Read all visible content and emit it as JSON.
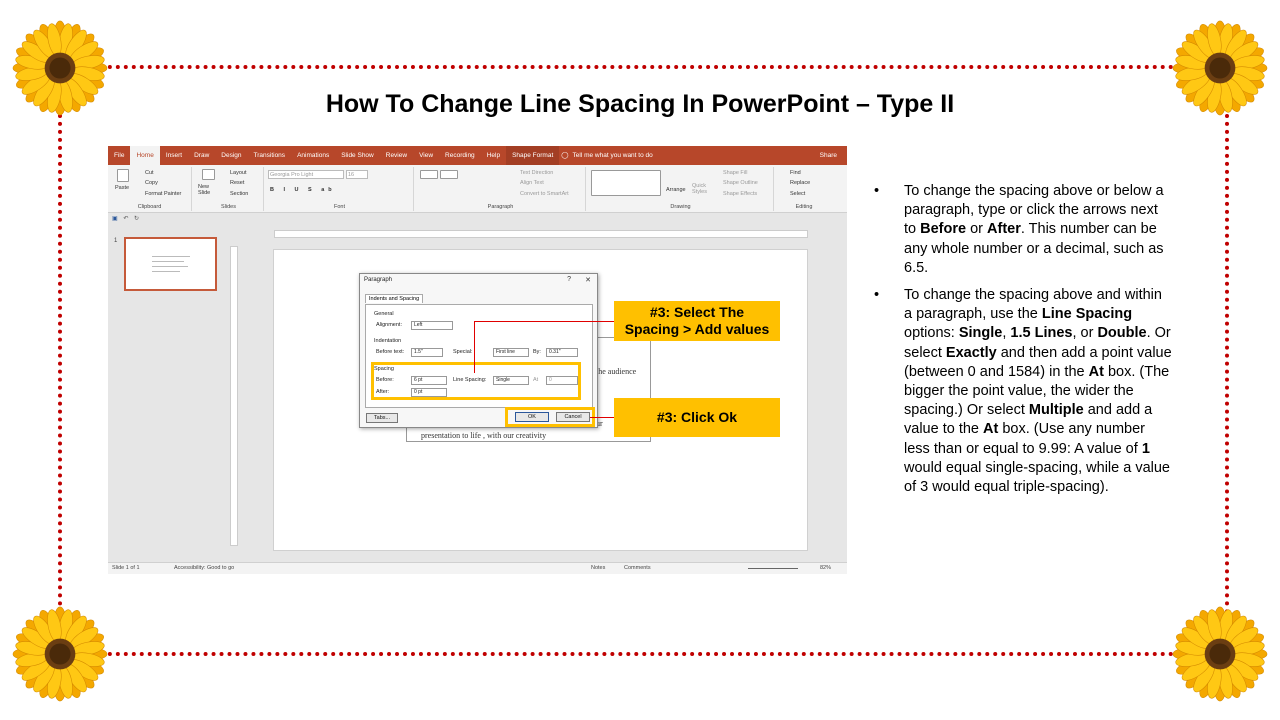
{
  "title": "How To Change Line Spacing In PowerPoint – Type II",
  "ribbon": {
    "tabs": [
      "File",
      "Home",
      "Insert",
      "Draw",
      "Design",
      "Transitions",
      "Animations",
      "Slide Show",
      "Review",
      "View",
      "Recording",
      "Help",
      "Shape Format"
    ],
    "active_tab": "Home",
    "tell_me": "Tell me what you want to do",
    "share": "Share",
    "clipboard": {
      "paste": "Paste",
      "cut": "Cut",
      "copy": "Copy",
      "format_painter": "Format Painter",
      "label": "Clipboard"
    },
    "slides": {
      "new_slide": "New Slide",
      "layout": "Layout",
      "reset": "Reset",
      "section": "Section",
      "label": "Slides"
    },
    "font": {
      "name": "Georgia Pro Light",
      "size": "16",
      "label": "Font"
    },
    "paragraph": {
      "text_direction": "Text Direction",
      "align_text": "Align Text",
      "convert_smartart": "Convert to SmartArt",
      "label": "Paragraph"
    },
    "drawing": {
      "arrange": "Arrange",
      "quick_styles": "Quick Styles",
      "shape_fill": "Shape Fill",
      "shape_outline": "Shape Outline",
      "shape_effects": "Shape Effects",
      "label": "Drawing"
    },
    "editing": {
      "find": "Find",
      "replace": "Replace",
      "select": "Select",
      "label": "Editing"
    }
  },
  "thumbnail_number": "1",
  "slide_text": {
    "line1": "s.",
    "line2": "the audience",
    "line3": "ur",
    "line4": "presentation to life , with our creativity"
  },
  "dialog": {
    "title": "Paragraph",
    "help": "?",
    "close": "✕",
    "tab": "Indents and Spacing",
    "general_label": "General",
    "alignment_label": "Alignment:",
    "alignment_value": "Left",
    "indentation_label": "Indentation",
    "before_text_label": "Before text:",
    "before_text_value": "1.5\"",
    "special_label": "Special:",
    "special_value": "First line",
    "by_label": "By:",
    "by_value": "0.31\"",
    "spacing_label": "Spacing",
    "before_label": "Before:",
    "before_value": "6 pt",
    "after_label": "After:",
    "after_value": "0 pt",
    "line_spacing_label": "Line Spacing:",
    "line_spacing_value": "Single",
    "at_label": "At",
    "at_value": "0",
    "tabs_button": "Tabs...",
    "ok_button": "OK",
    "cancel_button": "Cancel"
  },
  "statusbar": {
    "slide": "Slide 1 of 1",
    "accessibility": "Accessibility: Good to go",
    "notes": "Notes",
    "comments": "Comments",
    "zoom": "82%"
  },
  "callouts": {
    "select_spacing": "#3: Select The Spacing > Add values",
    "click_ok": "#3: Click Ok"
  },
  "bullets": [
    {
      "segments": [
        {
          "t": "To change the spacing above or below a paragraph, type or click the arrows next to ",
          "b": false
        },
        {
          "t": "Before",
          "b": true
        },
        {
          "t": " or ",
          "b": false
        },
        {
          "t": "After",
          "b": true
        },
        {
          "t": ". This number can be any whole number or a decimal, such as 6.5.",
          "b": false
        }
      ]
    },
    {
      "segments": [
        {
          "t": "To change the spacing above and within a paragraph, use the ",
          "b": false
        },
        {
          "t": "Line Spacing",
          "b": true
        },
        {
          "t": " options: ",
          "b": false
        },
        {
          "t": "Single",
          "b": true
        },
        {
          "t": ", ",
          "b": false
        },
        {
          "t": "1.5 Lines",
          "b": true
        },
        {
          "t": ", or ",
          "b": false
        },
        {
          "t": "Double",
          "b": true
        },
        {
          "t": ". Or select ",
          "b": false
        },
        {
          "t": "Exactly",
          "b": true
        },
        {
          "t": " and then add a point value (between 0 and 1584) in the ",
          "b": false
        },
        {
          "t": "At",
          "b": true
        },
        {
          "t": " box. (The bigger the point value, the wider the spacing.) Or select ",
          "b": false
        },
        {
          "t": "Multiple",
          "b": true
        },
        {
          "t": " and add a value to the ",
          "b": false
        },
        {
          "t": "At",
          "b": true
        },
        {
          "t": " box. (Use any number less than or equal to 9.99: A value of ",
          "b": false
        },
        {
          "t": "1",
          "b": true
        },
        {
          "t": " would equal single-spacing, while a value of 3 would equal triple-spacing).",
          "b": false
        }
      ]
    }
  ],
  "bullet_char": "•",
  "colors": {
    "frame": "#c00000",
    "callout": "#ffc000",
    "ppt_accent": "#b7472a",
    "connector": "#e00000"
  },
  "icons": [
    "sunflower-icon",
    "cut-icon",
    "copy-icon",
    "format-painter-icon",
    "find-icon",
    "lightbulb-icon",
    "save-icon",
    "undo-icon",
    "redo-icon"
  ]
}
